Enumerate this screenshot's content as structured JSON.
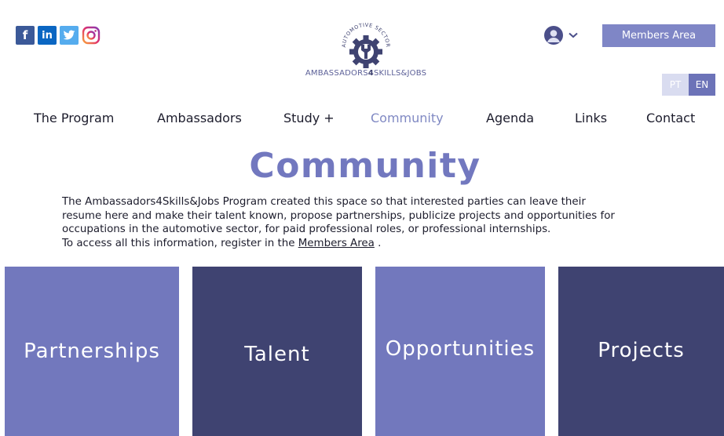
{
  "social": {
    "icons": [
      "facebook-icon",
      "linkedin-icon",
      "twitter-icon",
      "instagram-icon"
    ],
    "glyphs": {
      "facebook": "f",
      "linkedin": "in"
    }
  },
  "logo": {
    "arc_text": "AUTOMOTIVE SECTOR",
    "text_left": "AMBASSADORS",
    "text_num": "4",
    "text_right": "SKILLS&JOBS"
  },
  "header": {
    "members_label": "Members Area",
    "lang": {
      "pt": "PT",
      "en": "EN",
      "selected": "EN"
    }
  },
  "nav": {
    "items": [
      {
        "label": "The Program"
      },
      {
        "label": "Ambassadors"
      },
      {
        "label": "Study +"
      },
      {
        "label": "Community",
        "active": true
      },
      {
        "label": "Agenda"
      },
      {
        "label": "Links"
      },
      {
        "label": "Contact"
      }
    ]
  },
  "page": {
    "title": "Community",
    "intro_line1": "The Ambassadors4Skills&Jobs Program created this space so that interested parties can leave their",
    "intro_line2": "resume here and make their talent known, propose partnerships, publicize projects and opportunities for",
    "intro_line3": "occupations in the automotive sector, for paid professional roles, or professional internships.",
    "intro_line4_prefix": "To access all this information, register in the",
    "intro_link": "Members Area",
    "intro_line4_suffix": " ."
  },
  "tiles": [
    {
      "label": "Partnerships",
      "color": "#7278bd"
    },
    {
      "label": "Talent",
      "color": "#3f4371"
    },
    {
      "label": "Opportunities",
      "color": "#7278bd"
    },
    {
      "label": "Projects",
      "color": "#3f4371"
    }
  ],
  "colors": {
    "accent": "#7278bf",
    "dark_tile": "#3f4371",
    "light_tile": "#7278bd",
    "members_button": "#7f86c6"
  }
}
